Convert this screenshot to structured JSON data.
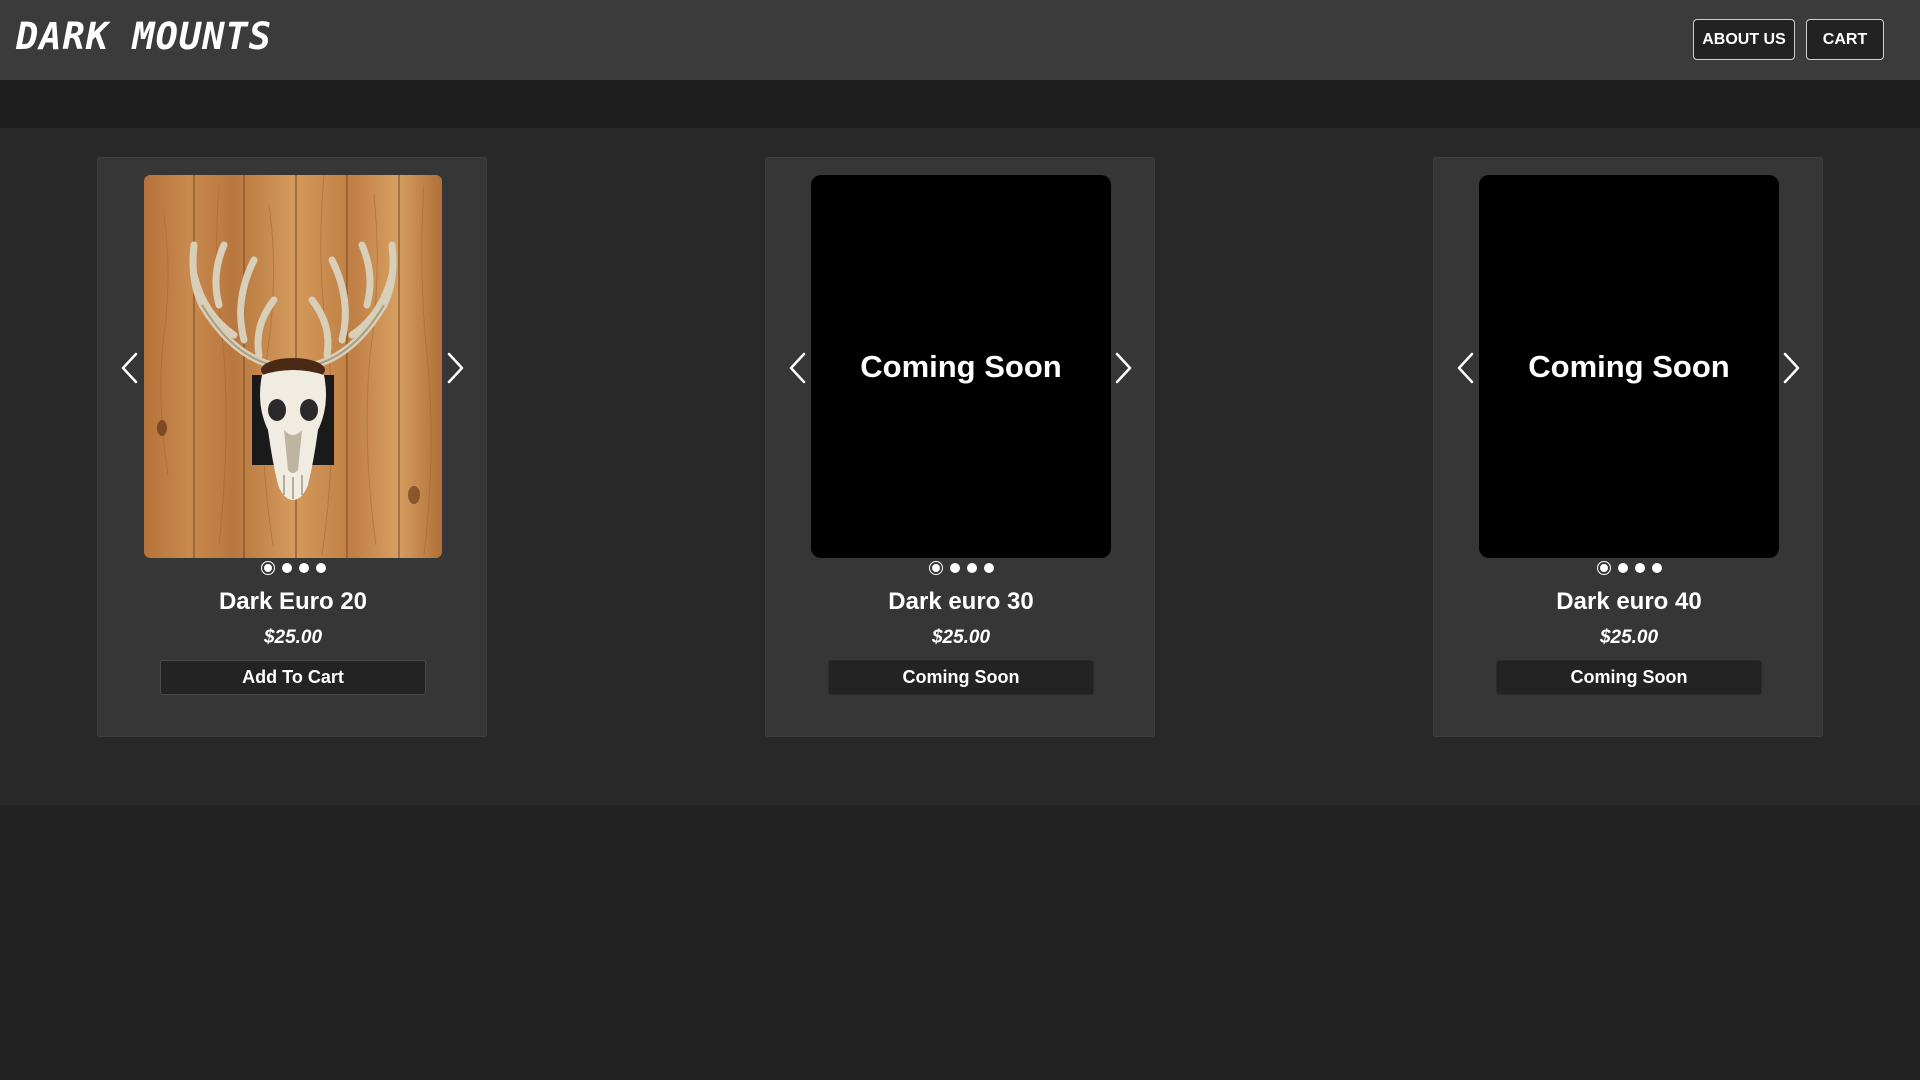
{
  "header": {
    "logo": "DARK MOUNTS",
    "nav": {
      "about_label": "ABOUT US",
      "cart_label": "CART"
    }
  },
  "products": [
    {
      "name": "Dark Euro 20",
      "price": "$25.00",
      "image": "deer-skull-euro-mount-on-wood",
      "overlay_text": "",
      "button_label": "Add To Cart",
      "carousel_dots": 4,
      "active_dot": 1
    },
    {
      "name": "Dark euro 30",
      "price": "$25.00",
      "image": "placeholder-black",
      "overlay_text": "Coming Soon",
      "button_label": "Coming Soon",
      "carousel_dots": 4,
      "active_dot": 1
    },
    {
      "name": "Dark euro 40",
      "price": "$25.00",
      "image": "placeholder-black",
      "overlay_text": "Coming Soon",
      "button_label": "Coming Soon",
      "carousel_dots": 4,
      "active_dot": 1
    }
  ],
  "colors": {
    "header_bg": "#3b3b3b",
    "page_bg": "#222222",
    "card_bg": "#363636",
    "button_bg": "#232323",
    "text": "#ffffff"
  },
  "icons": {
    "prev": "chevron-left-icon",
    "next": "chevron-right-icon"
  }
}
